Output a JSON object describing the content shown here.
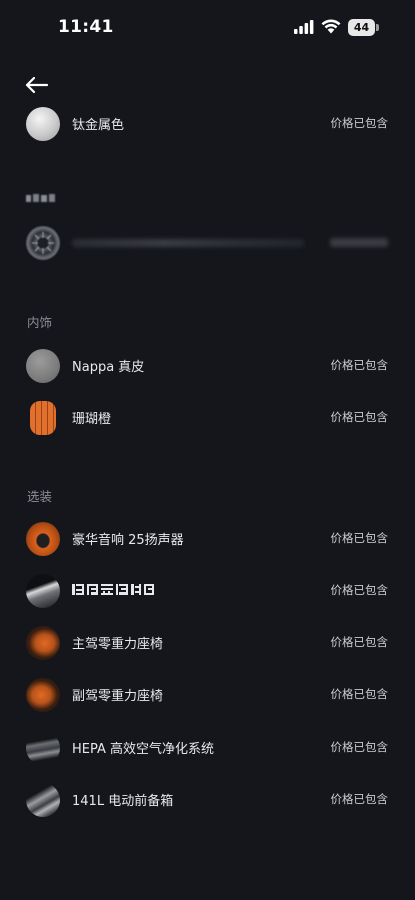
{
  "status_bar": {
    "time": "11:41",
    "battery": "44"
  },
  "sections": [
    {
      "title": "",
      "items": [
        {
          "label": "钛金属色",
          "price": "价格已包含"
        }
      ]
    },
    {
      "title": "",
      "items": [
        {
          "label": "",
          "price": ""
        }
      ]
    },
    {
      "title": "内饰",
      "items": [
        {
          "label": "Nappa 真皮",
          "price": "价格已包含"
        },
        {
          "label": "珊瑚橙",
          "price": "价格已包含"
        }
      ]
    },
    {
      "title": "选装",
      "items": [
        {
          "label": "豪华音响 25扬声器",
          "price": "价格已包含"
        },
        {
          "label": "",
          "price": "价格已包含"
        },
        {
          "label": "主驾零重力座椅",
          "price": "价格已包含"
        },
        {
          "label": "副驾零重力座椅",
          "price": "价格已包含"
        },
        {
          "label": "HEPA 高效空气净化系统",
          "price": "价格已包含"
        },
        {
          "label": "141L 电动前备箱",
          "price": "价格已包含"
        }
      ]
    }
  ],
  "colors": {
    "background": "#14161c",
    "text_primary": "#e8e9ec",
    "text_secondary": "#8b8e95",
    "accent_orange": "#d9621e"
  },
  "icons": [
    "back-arrow-icon",
    "signal-icon",
    "wifi-icon",
    "battery-icon"
  ]
}
